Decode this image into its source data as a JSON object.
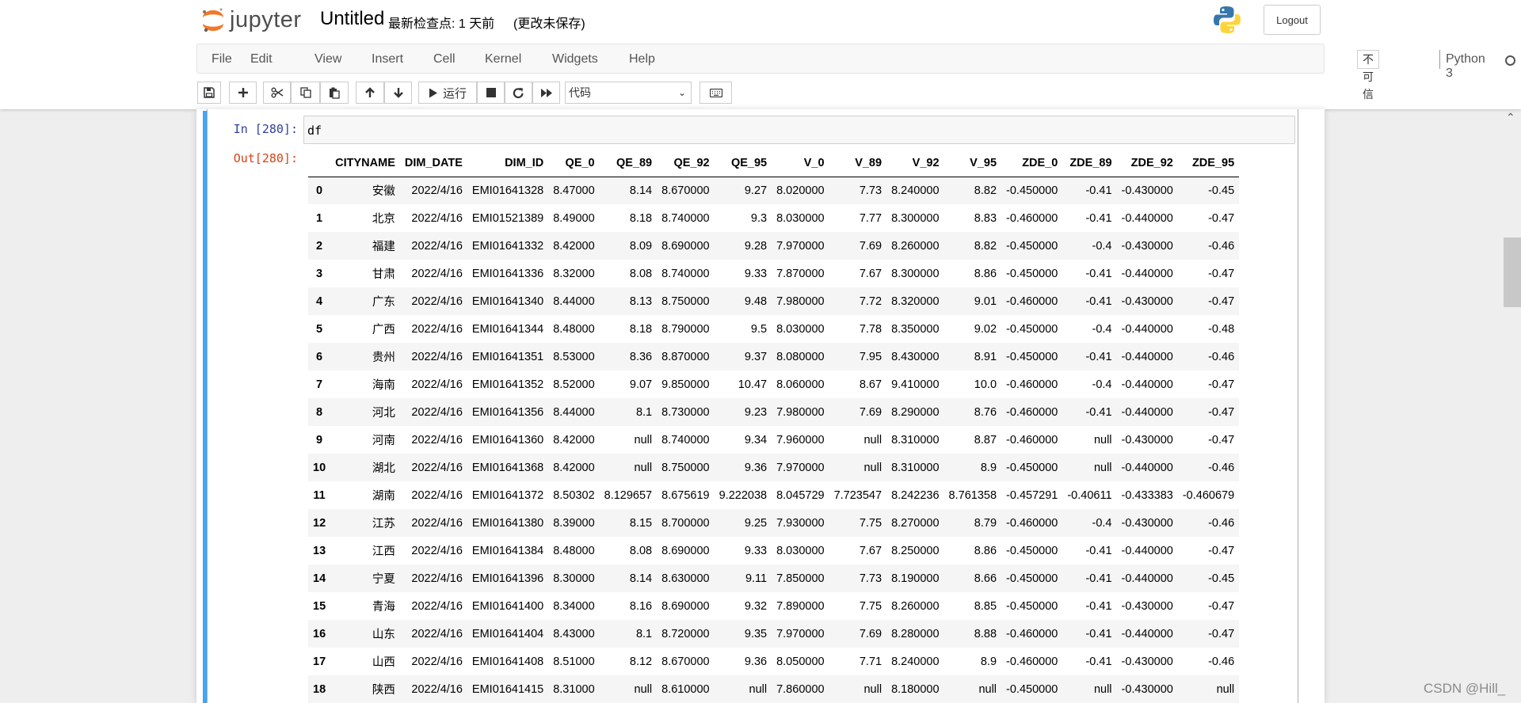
{
  "header": {
    "logo_text": "jupyter",
    "notebook_name": "Untitled",
    "checkpoint": "最新检查点: 1 天前",
    "autosave": "(更改未保存)",
    "logout": "Logout"
  },
  "menu": {
    "items": [
      "File",
      "Edit",
      "View",
      "Insert",
      "Cell",
      "Kernel",
      "Widgets",
      "Help"
    ],
    "trusted": "不可信",
    "kernel": "Python 3"
  },
  "toolbar": {
    "run_label": "运行",
    "cell_type": "代码",
    "icons": [
      "save-icon",
      "plus-icon",
      "cut-icon",
      "copy-icon",
      "paste-icon",
      "arrow-up-icon",
      "arrow-down-icon",
      "run-icon",
      "stop-icon",
      "restart-icon",
      "fast-forward-icon",
      "keyboard-icon"
    ]
  },
  "cell": {
    "in_prompt": "In  [280]:",
    "code": "df",
    "out_prompt": "Out[280]:"
  },
  "table": {
    "columns": [
      "",
      "CITYNAME",
      "DIM_DATE",
      "DIM_ID",
      "QE_0",
      "QE_89",
      "QE_92",
      "QE_95",
      "V_0",
      "V_89",
      "V_92",
      "V_95",
      "ZDE_0",
      "ZDE_89",
      "ZDE_92",
      "ZDE_95"
    ],
    "rows": [
      [
        "0",
        "安徽",
        "2022/4/16",
        "EMI01641328",
        "8.47000",
        "8.14",
        "8.670000",
        "9.27",
        "8.020000",
        "7.73",
        "8.240000",
        "8.82",
        "-0.450000",
        "-0.41",
        "-0.430000",
        "-0.45"
      ],
      [
        "1",
        "北京",
        "2022/4/16",
        "EMI01521389",
        "8.49000",
        "8.18",
        "8.740000",
        "9.3",
        "8.030000",
        "7.77",
        "8.300000",
        "8.83",
        "-0.460000",
        "-0.41",
        "-0.440000",
        "-0.47"
      ],
      [
        "2",
        "福建",
        "2022/4/16",
        "EMI01641332",
        "8.42000",
        "8.09",
        "8.690000",
        "9.28",
        "7.970000",
        "7.69",
        "8.260000",
        "8.82",
        "-0.450000",
        "-0.4",
        "-0.430000",
        "-0.46"
      ],
      [
        "3",
        "甘肃",
        "2022/4/16",
        "EMI01641336",
        "8.32000",
        "8.08",
        "8.740000",
        "9.33",
        "7.870000",
        "7.67",
        "8.300000",
        "8.86",
        "-0.450000",
        "-0.41",
        "-0.440000",
        "-0.47"
      ],
      [
        "4",
        "广东",
        "2022/4/16",
        "EMI01641340",
        "8.44000",
        "8.13",
        "8.750000",
        "9.48",
        "7.980000",
        "7.72",
        "8.320000",
        "9.01",
        "-0.460000",
        "-0.41",
        "-0.430000",
        "-0.47"
      ],
      [
        "5",
        "广西",
        "2022/4/16",
        "EMI01641344",
        "8.48000",
        "8.18",
        "8.790000",
        "9.5",
        "8.030000",
        "7.78",
        "8.350000",
        "9.02",
        "-0.450000",
        "-0.4",
        "-0.440000",
        "-0.48"
      ],
      [
        "6",
        "贵州",
        "2022/4/16",
        "EMI01641351",
        "8.53000",
        "8.36",
        "8.870000",
        "9.37",
        "8.080000",
        "7.95",
        "8.430000",
        "8.91",
        "-0.450000",
        "-0.41",
        "-0.440000",
        "-0.46"
      ],
      [
        "7",
        "海南",
        "2022/4/16",
        "EMI01641352",
        "8.52000",
        "9.07",
        "9.850000",
        "10.47",
        "8.060000",
        "8.67",
        "9.410000",
        "10.0",
        "-0.460000",
        "-0.4",
        "-0.440000",
        "-0.47"
      ],
      [
        "8",
        "河北",
        "2022/4/16",
        "EMI01641356",
        "8.44000",
        "8.1",
        "8.730000",
        "9.23",
        "7.980000",
        "7.69",
        "8.290000",
        "8.76",
        "-0.460000",
        "-0.41",
        "-0.440000",
        "-0.47"
      ],
      [
        "9",
        "河南",
        "2022/4/16",
        "EMI01641360",
        "8.42000",
        "null",
        "8.740000",
        "9.34",
        "7.960000",
        "null",
        "8.310000",
        "8.87",
        "-0.460000",
        "null",
        "-0.430000",
        "-0.47"
      ],
      [
        "10",
        "湖北",
        "2022/4/16",
        "EMI01641368",
        "8.42000",
        "null",
        "8.750000",
        "9.36",
        "7.970000",
        "null",
        "8.310000",
        "8.9",
        "-0.450000",
        "null",
        "-0.440000",
        "-0.46"
      ],
      [
        "11",
        "湖南",
        "2022/4/16",
        "EMI01641372",
        "8.50302",
        "8.129657",
        "8.675619",
        "9.222038",
        "8.045729",
        "7.723547",
        "8.242236",
        "8.761358",
        "-0.457291",
        "-0.40611",
        "-0.433383",
        "-0.460679"
      ],
      [
        "12",
        "江苏",
        "2022/4/16",
        "EMI01641380",
        "8.39000",
        "8.15",
        "8.700000",
        "9.25",
        "7.930000",
        "7.75",
        "8.270000",
        "8.79",
        "-0.460000",
        "-0.4",
        "-0.430000",
        "-0.46"
      ],
      [
        "13",
        "江西",
        "2022/4/16",
        "EMI01641384",
        "8.48000",
        "8.08",
        "8.690000",
        "9.33",
        "8.030000",
        "7.67",
        "8.250000",
        "8.86",
        "-0.450000",
        "-0.41",
        "-0.440000",
        "-0.47"
      ],
      [
        "14",
        "宁夏",
        "2022/4/16",
        "EMI01641396",
        "8.30000",
        "8.14",
        "8.630000",
        "9.11",
        "7.850000",
        "7.73",
        "8.190000",
        "8.66",
        "-0.450000",
        "-0.41",
        "-0.440000",
        "-0.45"
      ],
      [
        "15",
        "青海",
        "2022/4/16",
        "EMI01641400",
        "8.34000",
        "8.16",
        "8.690000",
        "9.32",
        "7.890000",
        "7.75",
        "8.260000",
        "8.85",
        "-0.450000",
        "-0.41",
        "-0.430000",
        "-0.47"
      ],
      [
        "16",
        "山东",
        "2022/4/16",
        "EMI01641404",
        "8.43000",
        "8.1",
        "8.720000",
        "9.35",
        "7.970000",
        "7.69",
        "8.280000",
        "8.88",
        "-0.460000",
        "-0.41",
        "-0.440000",
        "-0.47"
      ],
      [
        "17",
        "山西",
        "2022/4/16",
        "EMI01641408",
        "8.51000",
        "8.12",
        "8.670000",
        "9.36",
        "8.050000",
        "7.71",
        "8.240000",
        "8.9",
        "-0.460000",
        "-0.41",
        "-0.430000",
        "-0.46"
      ],
      [
        "18",
        "陕西",
        "2022/4/16",
        "EMI01641415",
        "8.31000",
        "null",
        "8.610000",
        "null",
        "7.860000",
        "null",
        "8.180000",
        "null",
        "-0.450000",
        "null",
        "-0.430000",
        "null"
      ]
    ]
  },
  "watermark": "CSDN @Hill_",
  "colors": {
    "selected_cell_bar": "#42a5f5",
    "in_prompt": "#303f9f",
    "out_prompt": "#d84315"
  }
}
